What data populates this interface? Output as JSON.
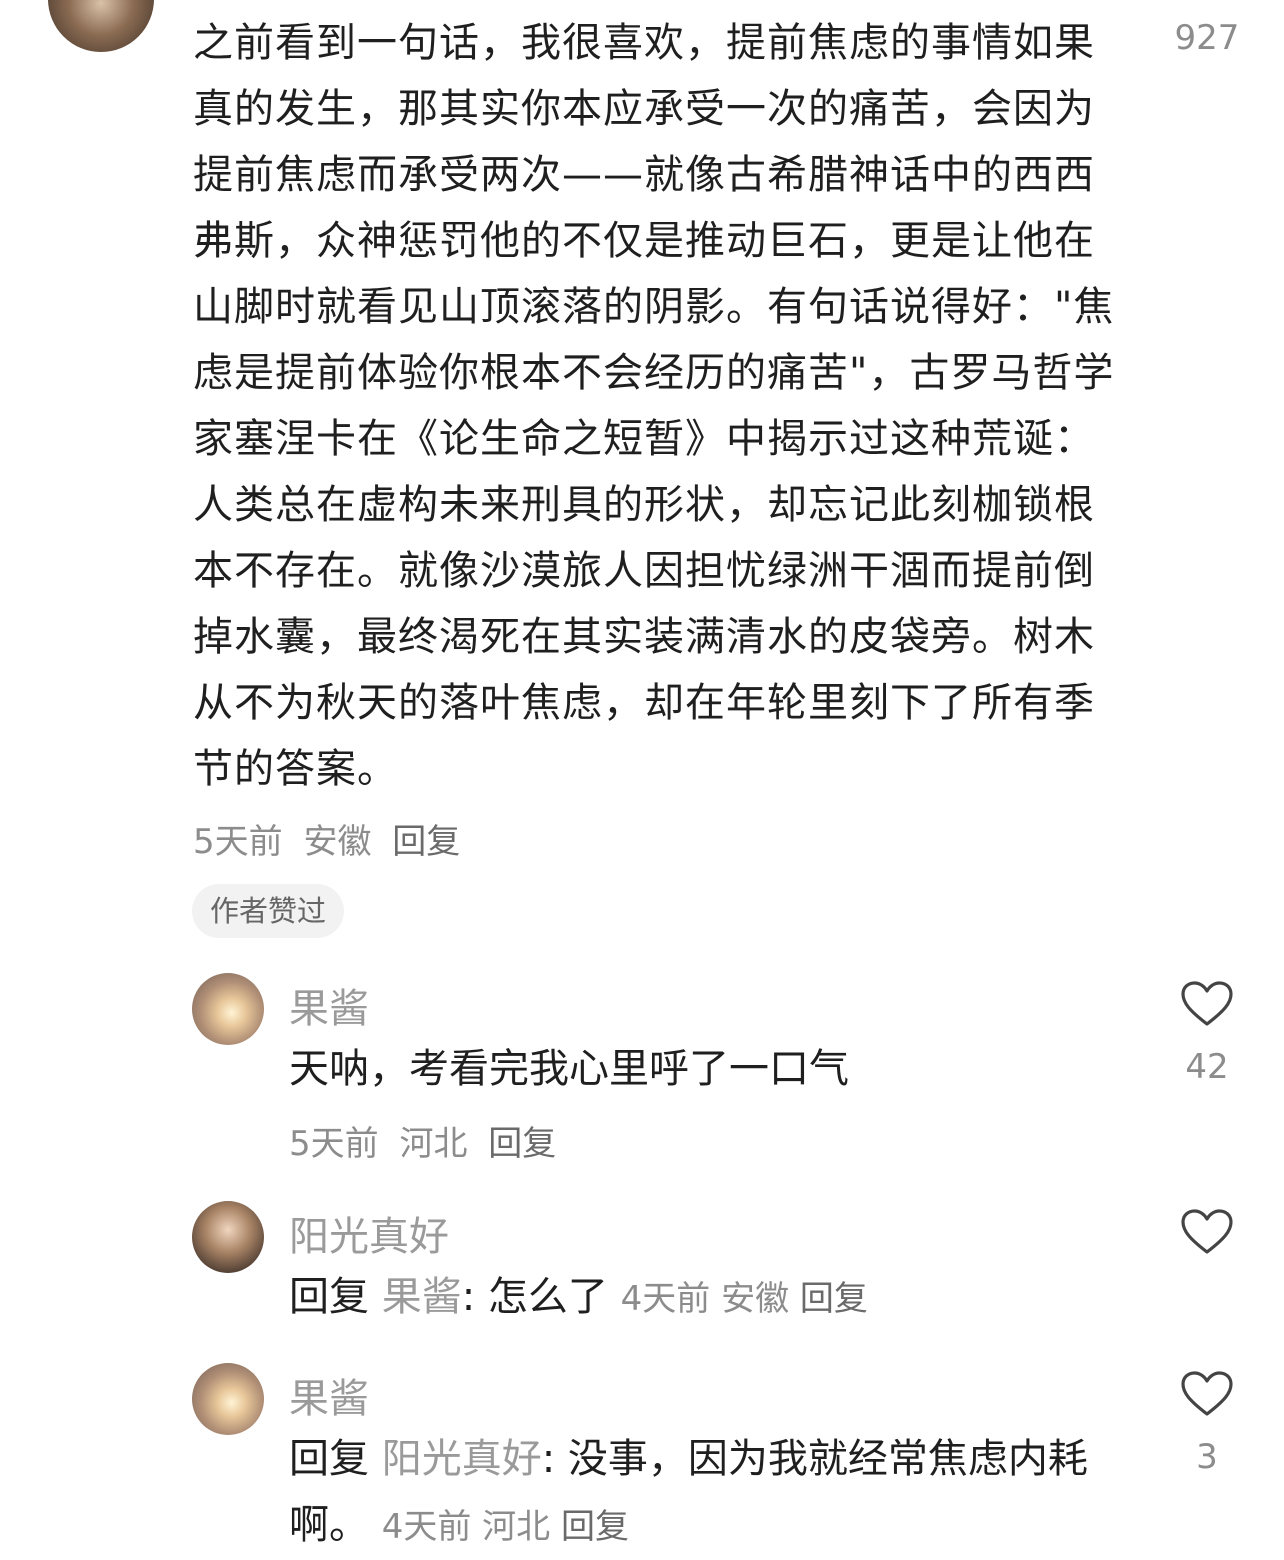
{
  "main_comment": {
    "text": "之前看到一句话，我很喜欢，提前焦虑的事情如果真的发生，那其实你本应承受一次的痛苦，会因为提前焦虑而承受两次——就像古希腊神话中的西西弗斯，众神惩罚他的不仅是推动巨石，更是让他在山脚时就看见山顶滚落的阴影。有句话说得好：\"焦虑是提前体验你根本不会经历的痛苦\"，古罗马哲学家塞涅卡在《论生命之短暂》中揭示过这种荒诞：人类总在虚构未来刑具的形状，却忘记此刻枷锁根本不存在。就像沙漠旅人因担忧绿洲干涸而提前倒掉水囊，最终渴死在其实装满清水的皮袋旁。树木从不为秋天的落叶焦虑，却在年轮里刻下了所有季节的答案。",
    "time": "5天前",
    "location": "安徽",
    "reply_label": "回复",
    "like_count": "927",
    "badge": "作者赞过"
  },
  "replies": [
    {
      "username": "果酱",
      "text": "天呐，考看完我心里呼了一口气",
      "time": "5天前",
      "location": "河北",
      "reply_label": "回复",
      "like_count": "42"
    },
    {
      "username": "阳光真好",
      "prefix": "回复",
      "mention": "果酱",
      "text": ": 怎么了",
      "time": "4天前",
      "location": "安徽",
      "reply_label": "回复",
      "like_count": ""
    },
    {
      "username": "果酱",
      "prefix": "回复",
      "mention": "阳光真好",
      "text": ": 没事，因为我就经常焦虑内耗啊。",
      "time": "4天前",
      "location": "河北",
      "reply_label": "回复",
      "like_count": "3"
    }
  ]
}
